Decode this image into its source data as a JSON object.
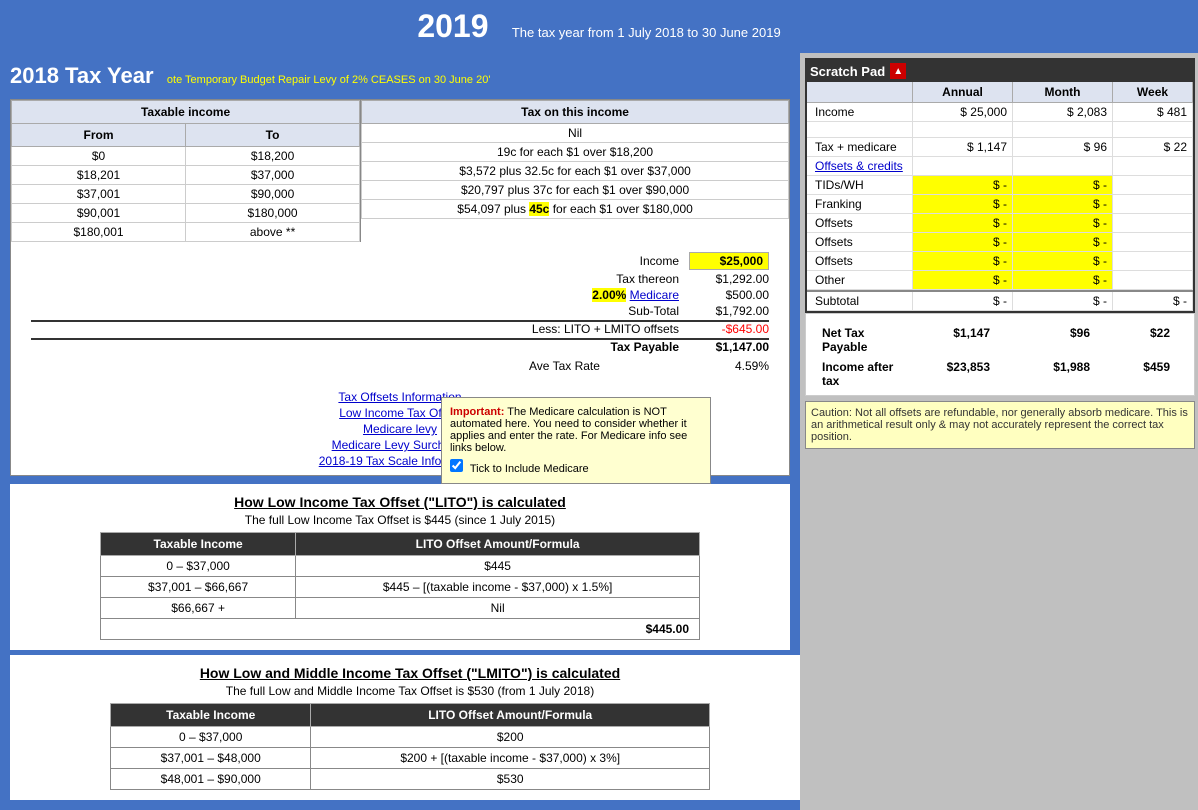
{
  "header": {
    "year": "2019",
    "subtitle": "The tax year from 1 July 2018 to 30 June 2019"
  },
  "taxYearTitle": "2018 Tax Year",
  "notice": "ote Temporary Budget Repair Levy of 2% CEASES on 30 June 20'",
  "taxableIncomeTable": {
    "header": "Taxable income",
    "col1": "From",
    "col2": "To",
    "rows": [
      {
        "from": "$0",
        "to": "$18,200"
      },
      {
        "from": "$18,201",
        "to": "$37,000"
      },
      {
        "from": "$37,001",
        "to": "$90,000"
      },
      {
        "from": "$90,001",
        "to": "$180,000"
      },
      {
        "from": "$180,001",
        "to": "above **"
      }
    ]
  },
  "taxOnIncomeTable": {
    "header": "Tax on this income",
    "rows": [
      "Nil",
      "19c for each $1 over $18,200",
      "$3,572 plus 32.5c for each $1 over $37,000",
      "$20,797 plus 37c for each $1 over $90,000",
      "$54,097 plus 45c for each $1 over $180,000"
    ],
    "highlight45c": "45c"
  },
  "calculation": {
    "incomeLabel": "Income",
    "incomeValue": "$25,000",
    "taxThereonLabel": "Tax thereon",
    "taxThereonValue": "$1,292.00",
    "medicareRate": "2.00%",
    "medicareLabel": "Medicare",
    "medicareValue": "$500.00",
    "subTotalLabel": "Sub-Total",
    "subTotalValue": "$1,792.00",
    "lessLabel": "Less: LITO + LMITO offsets",
    "lessValue": "-$645.00",
    "taxPayableLabel": "Tax Payable",
    "taxPayableValue": "$1,147.00",
    "aveTaxRateLabel": "Ave Tax Rate",
    "aveTaxRateValue": "4.59%"
  },
  "links": {
    "taxOffsets": "Tax Offsets Information",
    "lowIncomeTax": "Low Income Tax Offset",
    "medicareLevy": "Medicare levy",
    "medicareLevySurcharge": "Medicare Levy Surcharge",
    "taxScale": "2018-19 Tax Scale Information"
  },
  "tooltip": {
    "importantLabel": "Important:",
    "text": " The Medicare calculation is NOT automated here.  You need to consider whether it applies and enter the rate. For Medicare info see links below.",
    "checkboxLabel": "Tick to Include Medicare"
  },
  "scratchPad": {
    "title": "Scratch Pad",
    "columns": [
      "",
      "Annual",
      "Month",
      "Week"
    ],
    "rows": [
      {
        "label": "Income",
        "symbol": "$",
        "annual": "25,000",
        "month": "$",
        "monthVal": "2,083",
        "week": "$",
        "weekVal": "481"
      },
      {
        "label": "",
        "symbol": "",
        "annual": "",
        "month": "",
        "monthVal": "",
        "week": "",
        "weekVal": ""
      },
      {
        "label": "Tax + medicare",
        "symbol": "$",
        "annual": "1,147",
        "month": "$",
        "monthVal": "96",
        "week": "$",
        "weekVal": "22"
      },
      {
        "label": "Offsets & credits",
        "symbol": "",
        "annual": "",
        "month": "",
        "monthVal": "",
        "week": "",
        "weekVal": ""
      },
      {
        "label": "TIDs/WH",
        "symbol": "$",
        "annual": "-",
        "month": "$",
        "monthVal": "-",
        "week": "",
        "weekVal": ""
      },
      {
        "label": "Franking",
        "symbol": "$",
        "annual": "-",
        "month": "$",
        "monthVal": "-",
        "week": "",
        "weekVal": ""
      },
      {
        "label": "Offsets",
        "symbol": "$",
        "annual": "-",
        "month": "$",
        "monthVal": "-",
        "week": "",
        "weekVal": ""
      },
      {
        "label": "Offsets",
        "symbol": "$",
        "annual": "-",
        "month": "$",
        "monthVal": "-",
        "week": "",
        "weekVal": ""
      },
      {
        "label": "Offsets",
        "symbol": "$",
        "annual": "-",
        "month": "$",
        "monthVal": "-",
        "week": "",
        "weekVal": ""
      },
      {
        "label": "Other",
        "symbol": "$",
        "annual": "-",
        "month": "$",
        "monthVal": "-",
        "week": "",
        "weekVal": ""
      },
      {
        "label": "Subtotal",
        "symbol": "$",
        "annual": "-",
        "month": "$",
        "monthVal": "-",
        "week": "$",
        "weekVal": "-"
      }
    ],
    "netTaxPayable": {
      "label": "Net Tax Payable",
      "annual": "$1,147",
      "month": "$96",
      "week": "$22"
    },
    "incomeAfterTax": {
      "label": "Income after tax",
      "annual": "$23,853",
      "month": "$1,988",
      "week": "$459"
    }
  },
  "caution": "Caution: Not all offsets are refundable, nor generally absorb medicare. This is an arithmetical result only & may not accurately represent the correct tax position.",
  "litoSection": {
    "title": "How Low Income Tax Offset (\"LITO\") is calculated",
    "subtitle": "The full Low Income Tax Offset is $445 (since 1 July 2015)",
    "columns": [
      "Taxable Income",
      "LITO Offset Amount/Formula"
    ],
    "rows": [
      {
        "income": "0 – $37,000",
        "formula": "$445"
      },
      {
        "income": "$37,001 – $66,667",
        "formula": "$445 – [(taxable income - $37,000) x 1.5%]"
      },
      {
        "income": "$66,667 +",
        "formula": "Nil"
      }
    ],
    "totalRow": "$445.00"
  },
  "lmitoSection": {
    "title": "How Low and Middle Income Tax Offset (\"LMITO\") is calculated",
    "subtitle": "The full Low and Middle Income Tax Offset is $530 (from 1 July 2018)",
    "columns": [
      "Taxable Income",
      "LITO Offset Amount/Formula"
    ],
    "rows": [
      {
        "income": "0 – $37,000",
        "formula": "$200"
      },
      {
        "income": "$37,001 – $48,000",
        "formula": "$200 + [(taxable income - $37,000) x 3%]"
      },
      {
        "income": "$48,001 – $90,000",
        "formula": "$530"
      }
    ]
  }
}
